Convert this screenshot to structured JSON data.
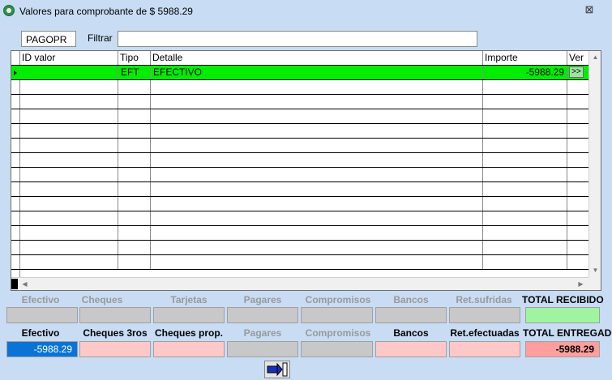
{
  "window": {
    "title": "Valores para comprobante de $ 5988.29",
    "close_glyph": "⊠"
  },
  "code": "PAGOPR",
  "filter": {
    "label": "Filtrar",
    "value": ""
  },
  "grid": {
    "columns": [
      "ID valor",
      "Tipo",
      "Detalle",
      "Importe",
      "Ver"
    ],
    "rows": [
      {
        "id": "",
        "tipo": "EFT",
        "detalle": "EFECTIVO",
        "importe": "-5988.29",
        "ver": ">>"
      }
    ]
  },
  "received": {
    "labels": [
      "Efectivo",
      "Cheques",
      "Tarjetas",
      "Pagares",
      "Compromisos",
      "Bancos",
      "Ret.sufridas",
      "TOTAL RECIBIDO"
    ],
    "values": [
      "",
      "",
      "",
      "",
      "",
      "",
      "",
      ""
    ]
  },
  "delivered": {
    "labels": [
      "Efectivo",
      "Cheques 3ros",
      "Cheques prop.",
      "Pagares",
      "Compromisos",
      "Bancos",
      "Ret.efectuadas",
      "TOTAL ENTREGADO"
    ],
    "values": [
      "-5988.29",
      "",
      "",
      "",
      "",
      "",
      "",
      "-5988.29"
    ]
  },
  "icons": {
    "app": "app-icon",
    "exit": "exit-door-icon"
  }
}
